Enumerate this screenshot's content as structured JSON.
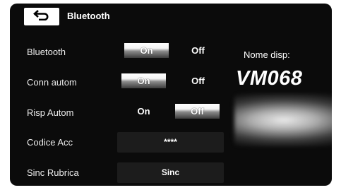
{
  "header": {
    "title": "Bluetooth",
    "back_icon": "back-arrow-icon"
  },
  "rows": [
    {
      "label": "Bluetooth",
      "on": "On",
      "off": "Off",
      "selected": "on"
    },
    {
      "label": "Conn autom",
      "on": "On",
      "off": "Off",
      "selected": "on"
    },
    {
      "label": "Risp Autom",
      "on": "On",
      "off": "Off",
      "selected": "off"
    },
    {
      "label": "Codice Acc",
      "value": "****"
    },
    {
      "label": "Sinc Rubrica",
      "value": "Sinc"
    }
  ],
  "device": {
    "label": "Nome disp:",
    "name": "VM068"
  },
  "colors": {
    "background": "#0b0b0b",
    "text": "#ffffff",
    "selected_option": "#ffffff",
    "field_button": "#1c1c1c"
  }
}
